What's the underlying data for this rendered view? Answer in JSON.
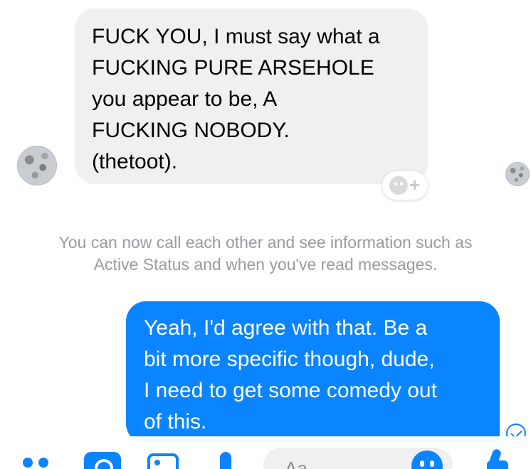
{
  "incoming_message": {
    "text": "FUCK YOU, I must say what a\nFUCKING PURE ARSEHOLE\nyou appear to be, A\nFUCKING NOBODY.\n(thetoot)."
  },
  "reaction_button": {
    "plus": "+"
  },
  "system_message": {
    "text": "You can now call each other and see information such as\nActive Status and when you've read messages."
  },
  "outgoing_message": {
    "text": "Yeah, I'd agree with that. Be a\nbit more specific though, dude,\nI need to get some comedy out\nof this."
  },
  "composer": {
    "placeholder": "Aa"
  },
  "colors": {
    "accent": "#0a84ff",
    "incoming_bubble": "#f1f0f0",
    "system_text": "#9a9a9f"
  },
  "icons": [
    "avatar",
    "reaction-icon",
    "read-receipt-icon",
    "more-icon",
    "camera-icon",
    "photo-icon",
    "microphone-icon",
    "emoji-icon",
    "like-icon"
  ]
}
